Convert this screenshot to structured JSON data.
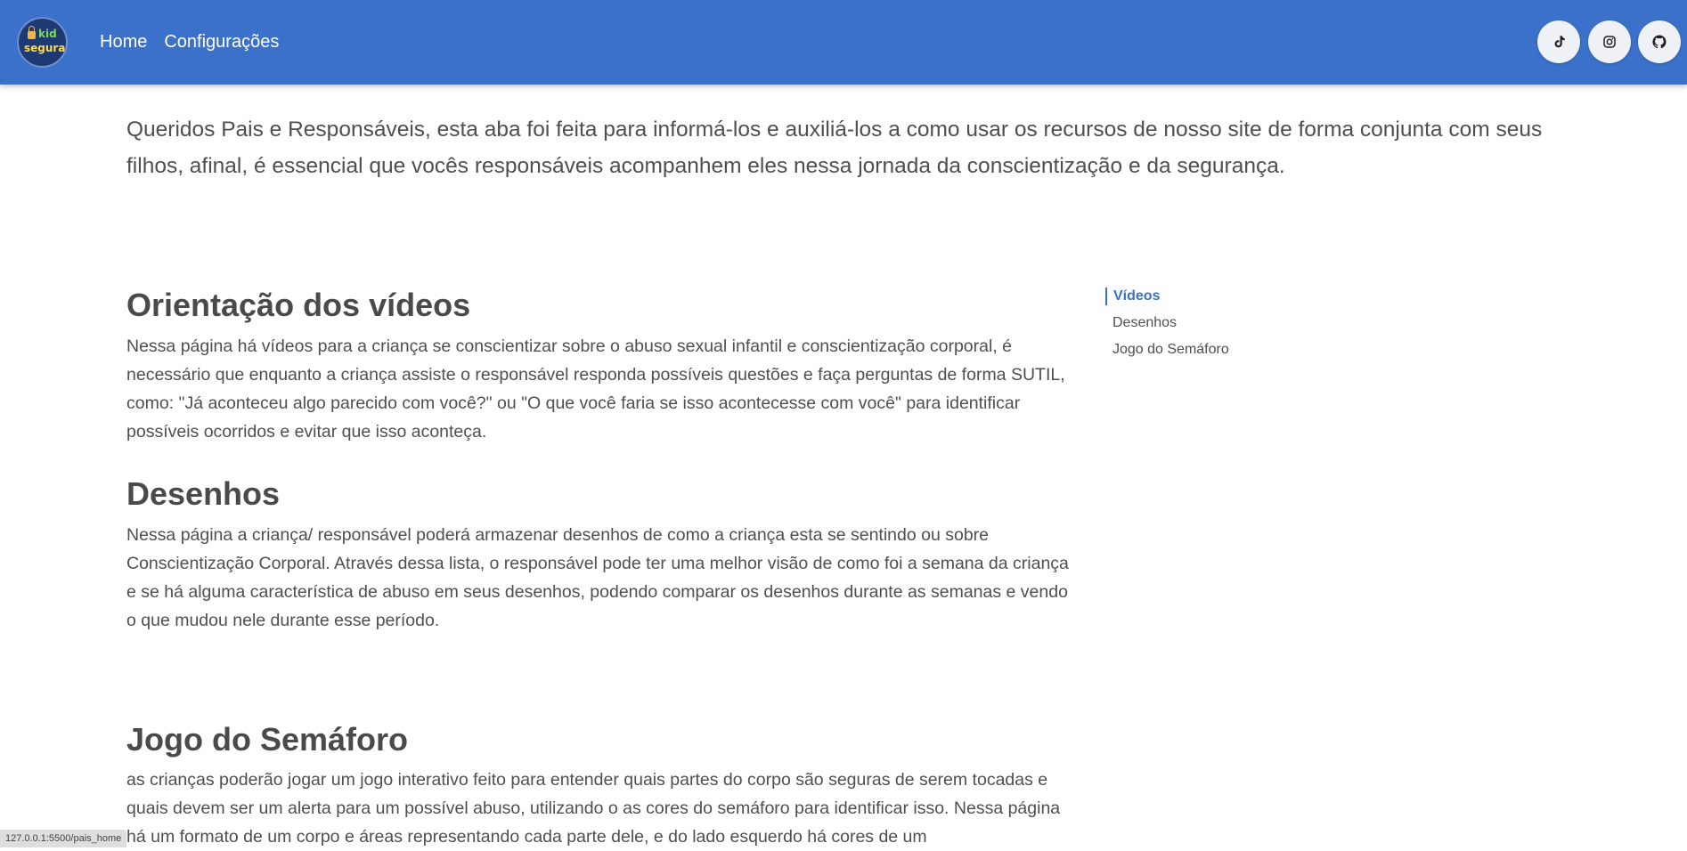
{
  "header": {
    "logo_text": [
      "kid",
      "segura"
    ],
    "nav": [
      {
        "label": "Home"
      },
      {
        "label": "Configurações"
      }
    ],
    "social": [
      {
        "icon": "tiktok-icon"
      },
      {
        "icon": "instagram-icon"
      },
      {
        "icon": "github-icon"
      }
    ]
  },
  "intro": "Queridos Pais e Responsáveis, esta aba foi feita para informá-los e auxiliá-los a como usar os recursos de nosso site de forma conjunta com seus filhos, afinal, é essencial que vocês responsáveis acompanhem eles nessa jornada da conscientização e da segurança.",
  "sections": [
    {
      "title": "Orientação dos vídeos",
      "body": "Nessa página há vídeos para a criança se conscientizar sobre o abuso sexual infantil e conscientização corporal, é necessário que enquanto a criança assiste o responsável responda possíveis questões e faça perguntas de forma SUTIL, como: \"Já aconteceu algo parecido com você?\" ou \"O que você faria se isso acontecesse com você\" para identificar possíveis ocorridos e evitar que isso aconteça."
    },
    {
      "title": "Desenhos",
      "body": "Nessa página a criança/ responsável poderá armazenar desenhos de como a criança esta se sentindo ou sobre Conscientização Corporal. Através dessa lista, o responsável pode ter uma melhor visão de como foi a semana da criança e se há alguma característica de abuso em seus desenhos, podendo comparar os desenhos durante as semanas e vendo o que mudou nele durante esse período."
    },
    {
      "title": "Jogo do Semáforo",
      "body": "as crianças poderão jogar um jogo interativo feito para entender quais partes do corpo são seguras de serem tocadas e quais devem ser um alerta para um possível abuso, utilizando o as cores do semáforo para identificar isso. Nessa página há um formato de um corpo e áreas representando cada parte dele, e do lado esquerdo há cores de um"
    }
  ],
  "toc": [
    {
      "label": "Vídeos",
      "active": true
    },
    {
      "label": "Desenhos",
      "active": false
    },
    {
      "label": "Jogo do Semáforo",
      "active": false
    }
  ],
  "status_url": "127.0.0.1:5500/pais_home",
  "colors": {
    "primary": "#3b71ca",
    "text": "#4f4f4f"
  }
}
